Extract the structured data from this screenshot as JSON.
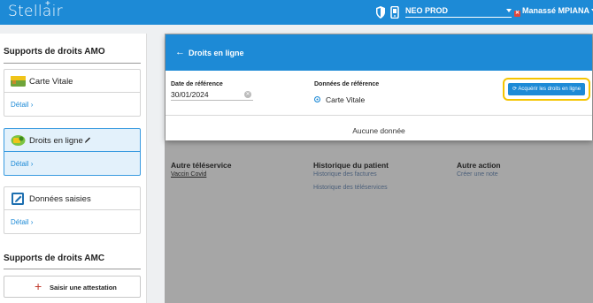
{
  "app": {
    "logo": "Stellair",
    "logo_mark": "+"
  },
  "topbar": {
    "site_name": "NEO PROD",
    "user_name": "Manassé MPIANA"
  },
  "left": {
    "amo_title": "Supports de droits AMO",
    "amo_cards": [
      {
        "label": "Carte Vitale",
        "detail": "Détail"
      },
      {
        "label": "Droits en ligne",
        "detail": "Détail"
      },
      {
        "label": "Données saisies",
        "detail": "Détail"
      }
    ],
    "amc_title": "Supports de droits AMC",
    "attestation_label": "Saisir une attestation"
  },
  "background": {
    "other_teleservice": {
      "title": "Autre téléservice",
      "link": "Vaccin Covid"
    },
    "patient_history": {
      "title": "Historique du patient",
      "links": [
        "Historique des factures",
        "Historique des téléservices"
      ]
    },
    "other_action": {
      "title": "Autre action",
      "link": "Créer une note"
    }
  },
  "modal": {
    "title": "Droits en ligne",
    "date_label": "Date de référence",
    "date_value": "30/01/2024",
    "ref_label": "Données de référence",
    "ref_option": "Carte Vitale",
    "acquire_label": "Acquérir les droits en ligne",
    "empty_text": "Aucune donnée"
  },
  "colors": {
    "primary": "#1d8ad6",
    "highlight": "#f5c400",
    "overlay": "#a6a6a6"
  },
  "icons": [
    "shield-icon",
    "phone-icon",
    "card-icon",
    "pencil-icon",
    "edit-icon",
    "refresh-icon",
    "plus-icon",
    "arrow-left-icon",
    "chevron-right-icon"
  ]
}
